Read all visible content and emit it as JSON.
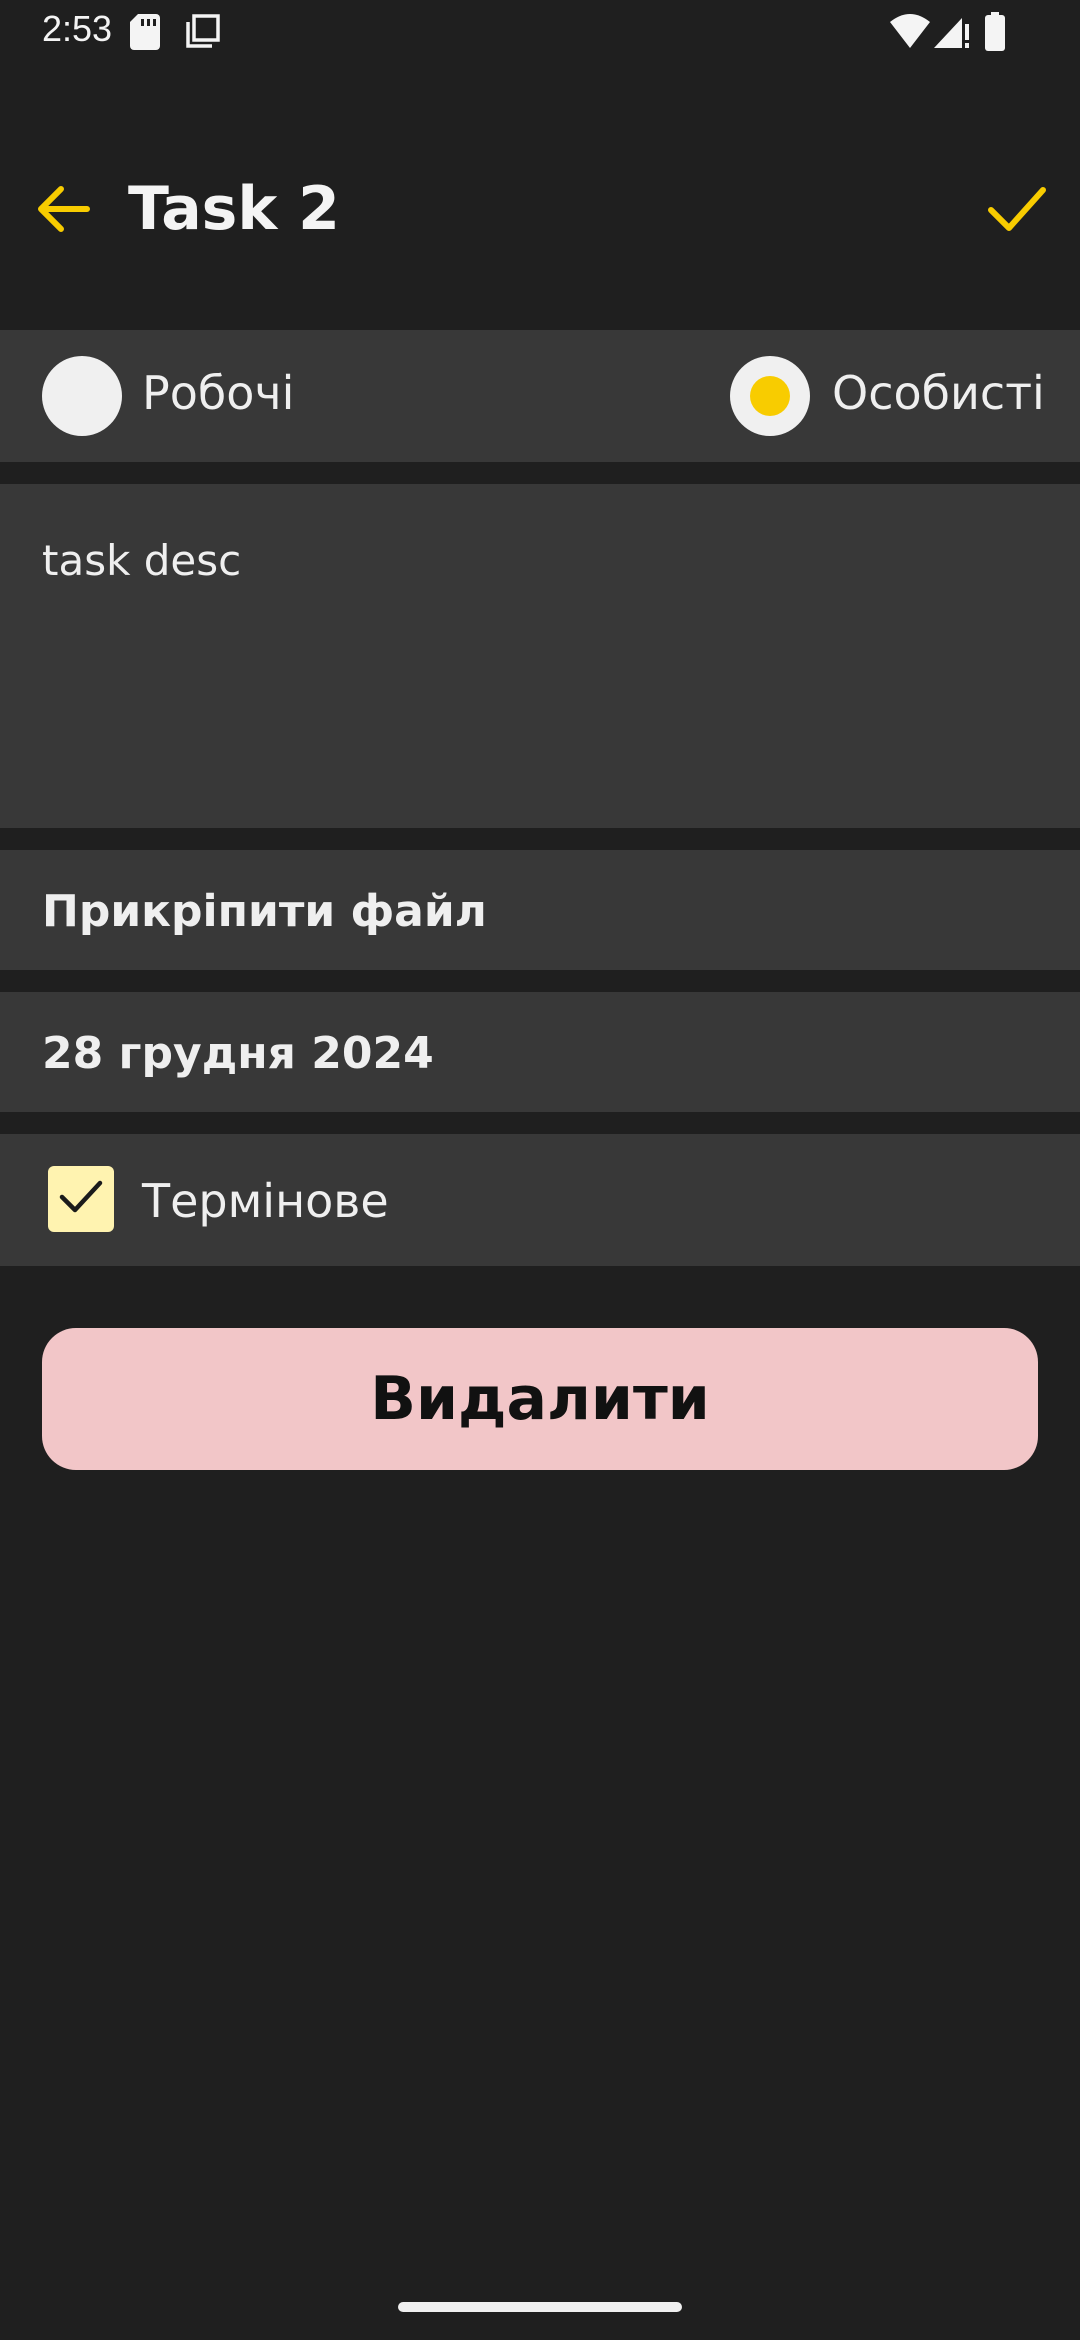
{
  "status_bar": {
    "time": "2:53",
    "icons": [
      "sd-card-icon",
      "copy-icon",
      "wifi-icon",
      "signal-icon",
      "battery-icon"
    ]
  },
  "app_bar": {
    "title": "Task 2",
    "back_icon": "arrow-left-icon",
    "confirm_icon": "check-icon"
  },
  "category": {
    "options": [
      {
        "label": "Робочі",
        "selected": false
      },
      {
        "label": "Особисті",
        "selected": true
      }
    ]
  },
  "description": {
    "text": "task desc"
  },
  "attach": {
    "label": "Прикріпити файл"
  },
  "date": {
    "value": "28 грудня 2024"
  },
  "urgent": {
    "label": "Термінове",
    "checked": true
  },
  "delete_button": {
    "label": "Видалити"
  },
  "colors": {
    "accent": "#f8cc00",
    "background": "#1f1f1f",
    "surface": "#383838",
    "delete_bg": "#f2c6c8",
    "checkbox_bg": "#fff3b0"
  }
}
